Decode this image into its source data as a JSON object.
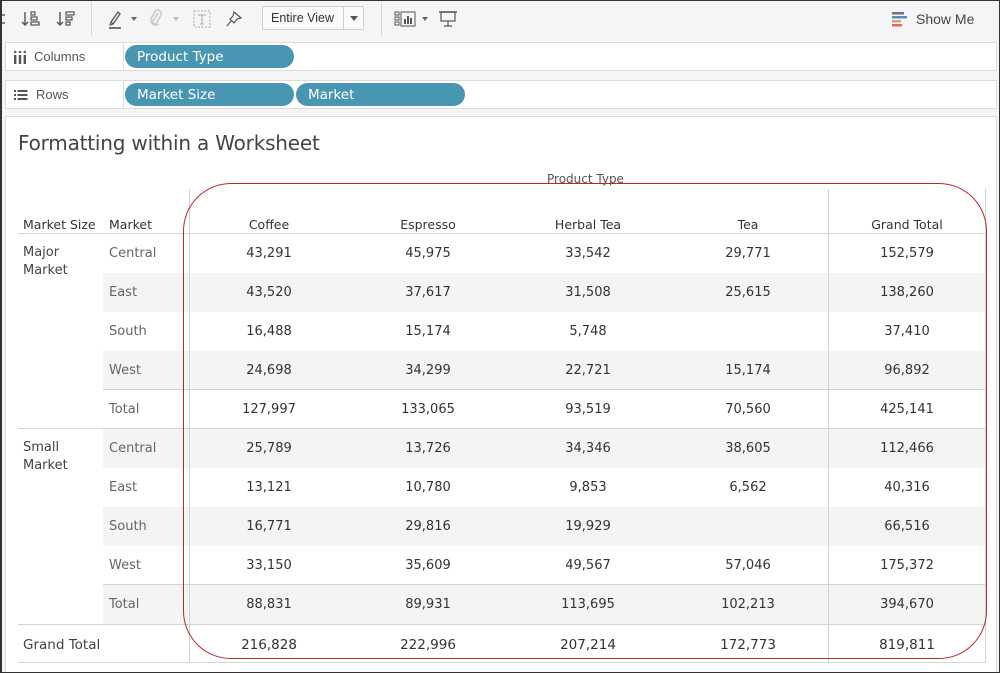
{
  "toolbar": {
    "icons": [
      "sort-ascending-icon",
      "sort-descending-icon",
      "highlight-icon",
      "attach-icon",
      "text-label-icon",
      "pin-icon",
      "card-layout-icon",
      "presentation-icon"
    ],
    "fit_select": {
      "value": "Entire View"
    },
    "show_me_label": "Show Me"
  },
  "shelves": {
    "columns": {
      "label": "Columns",
      "pills": [
        "Product Type"
      ]
    },
    "rows": {
      "label": "Rows",
      "pills": [
        "Market Size",
        "Market"
      ]
    }
  },
  "worksheet": {
    "title": "Formatting within a Worksheet",
    "column_group_header": "Product Type",
    "row_headers": [
      "Market Size",
      "Market"
    ],
    "columns": [
      "Coffee",
      "Espresso",
      "Herbal Tea",
      "Tea",
      "Grand Total"
    ],
    "groups": [
      {
        "name_line1": "Major",
        "name_line2": "Market",
        "rows": [
          {
            "market": "Central",
            "values": [
              "43,291",
              "45,975",
              "33,542",
              "29,771",
              "152,579"
            ]
          },
          {
            "market": "East",
            "values": [
              "43,520",
              "37,617",
              "31,508",
              "25,615",
              "138,260"
            ]
          },
          {
            "market": "South",
            "values": [
              "16,488",
              "15,174",
              "5,748",
              "",
              "37,410"
            ]
          },
          {
            "market": "West",
            "values": [
              "24,698",
              "34,299",
              "22,721",
              "15,174",
              "96,892"
            ]
          },
          {
            "market": "Total",
            "values": [
              "127,997",
              "133,065",
              "93,519",
              "70,560",
              "425,141"
            ]
          }
        ]
      },
      {
        "name_line1": "Small",
        "name_line2": "Market",
        "rows": [
          {
            "market": "Central",
            "values": [
              "25,789",
              "13,726",
              "34,346",
              "38,605",
              "112,466"
            ]
          },
          {
            "market": "East",
            "values": [
              "13,121",
              "10,780",
              "9,853",
              "6,562",
              "40,316"
            ]
          },
          {
            "market": "South",
            "values": [
              "16,771",
              "29,816",
              "19,929",
              "",
              "66,516"
            ]
          },
          {
            "market": "West",
            "values": [
              "33,150",
              "35,609",
              "49,567",
              "57,046",
              "175,372"
            ]
          },
          {
            "market": "Total",
            "values": [
              "88,831",
              "89,931",
              "113,695",
              "102,213",
              "394,670"
            ]
          }
        ]
      }
    ],
    "grand_total": {
      "label": "Grand Total",
      "values": [
        "216,828",
        "222,996",
        "207,214",
        "172,773",
        "819,811"
      ]
    }
  },
  "colors": {
    "pill": "#4996b2",
    "annotation": "#c0272d",
    "band": "#f4f4f4"
  }
}
